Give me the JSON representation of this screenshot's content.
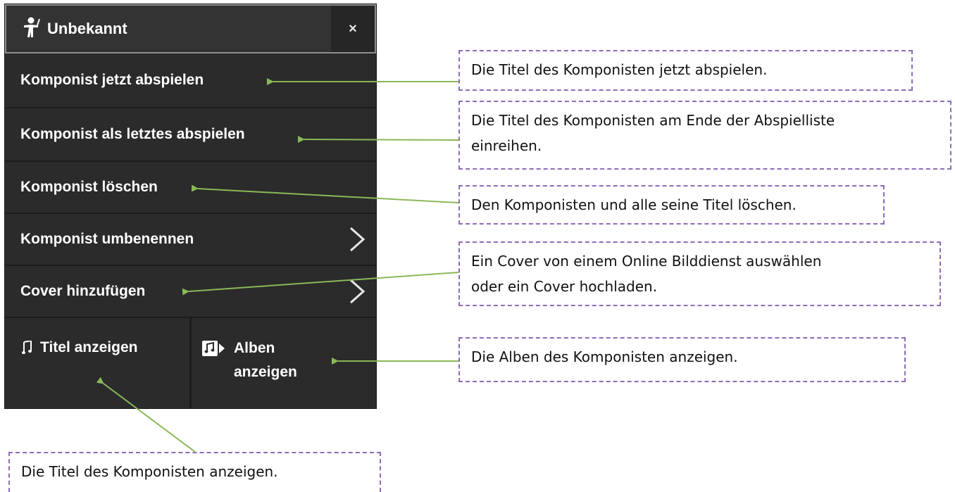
{
  "menu": {
    "header": {
      "title": "Unbekannt",
      "title_icon": "conductor-icon",
      "close_label": "×"
    },
    "items": [
      {
        "label": "Komponist jetzt abspielen",
        "has_submenu": false
      },
      {
        "label": "Komponist als letztes abspielen",
        "has_submenu": false
      },
      {
        "label": "Komponist löschen",
        "has_submenu": false
      },
      {
        "label": "Komponist umbenennen",
        "has_submenu": true
      },
      {
        "label": "Cover hinzufügen",
        "has_submenu": true
      }
    ],
    "bottom_buttons": {
      "titel": {
        "label": "Titel anzeigen",
        "icon": "music-note-icon"
      },
      "alben": {
        "label_line1": "Alben",
        "label_line2": "anzeigen",
        "icon": "album-icon"
      }
    }
  },
  "callouts": {
    "play_now": "Die Titel des Komponisten jetzt abspielen.",
    "play_last_line1": "Die Titel des Komponisten am Ende der Abspielliste",
    "play_last_line2": "einreihen.",
    "delete": "Den Komponisten und alle seine Titel löschen.",
    "cover_line1": "Ein Cover von einem Online Bilddienst auswählen",
    "cover_line2": "oder ein Cover hochladen.",
    "albums": "Die Alben des Komponisten anzeigen.",
    "titles": "Die Titel des Komponisten anzeigen."
  },
  "colors": {
    "menu_bg": "#2b2b2b",
    "header_bg": "#333333",
    "arrow": "#8ab85a",
    "callout_border": "#8e6bb8"
  }
}
